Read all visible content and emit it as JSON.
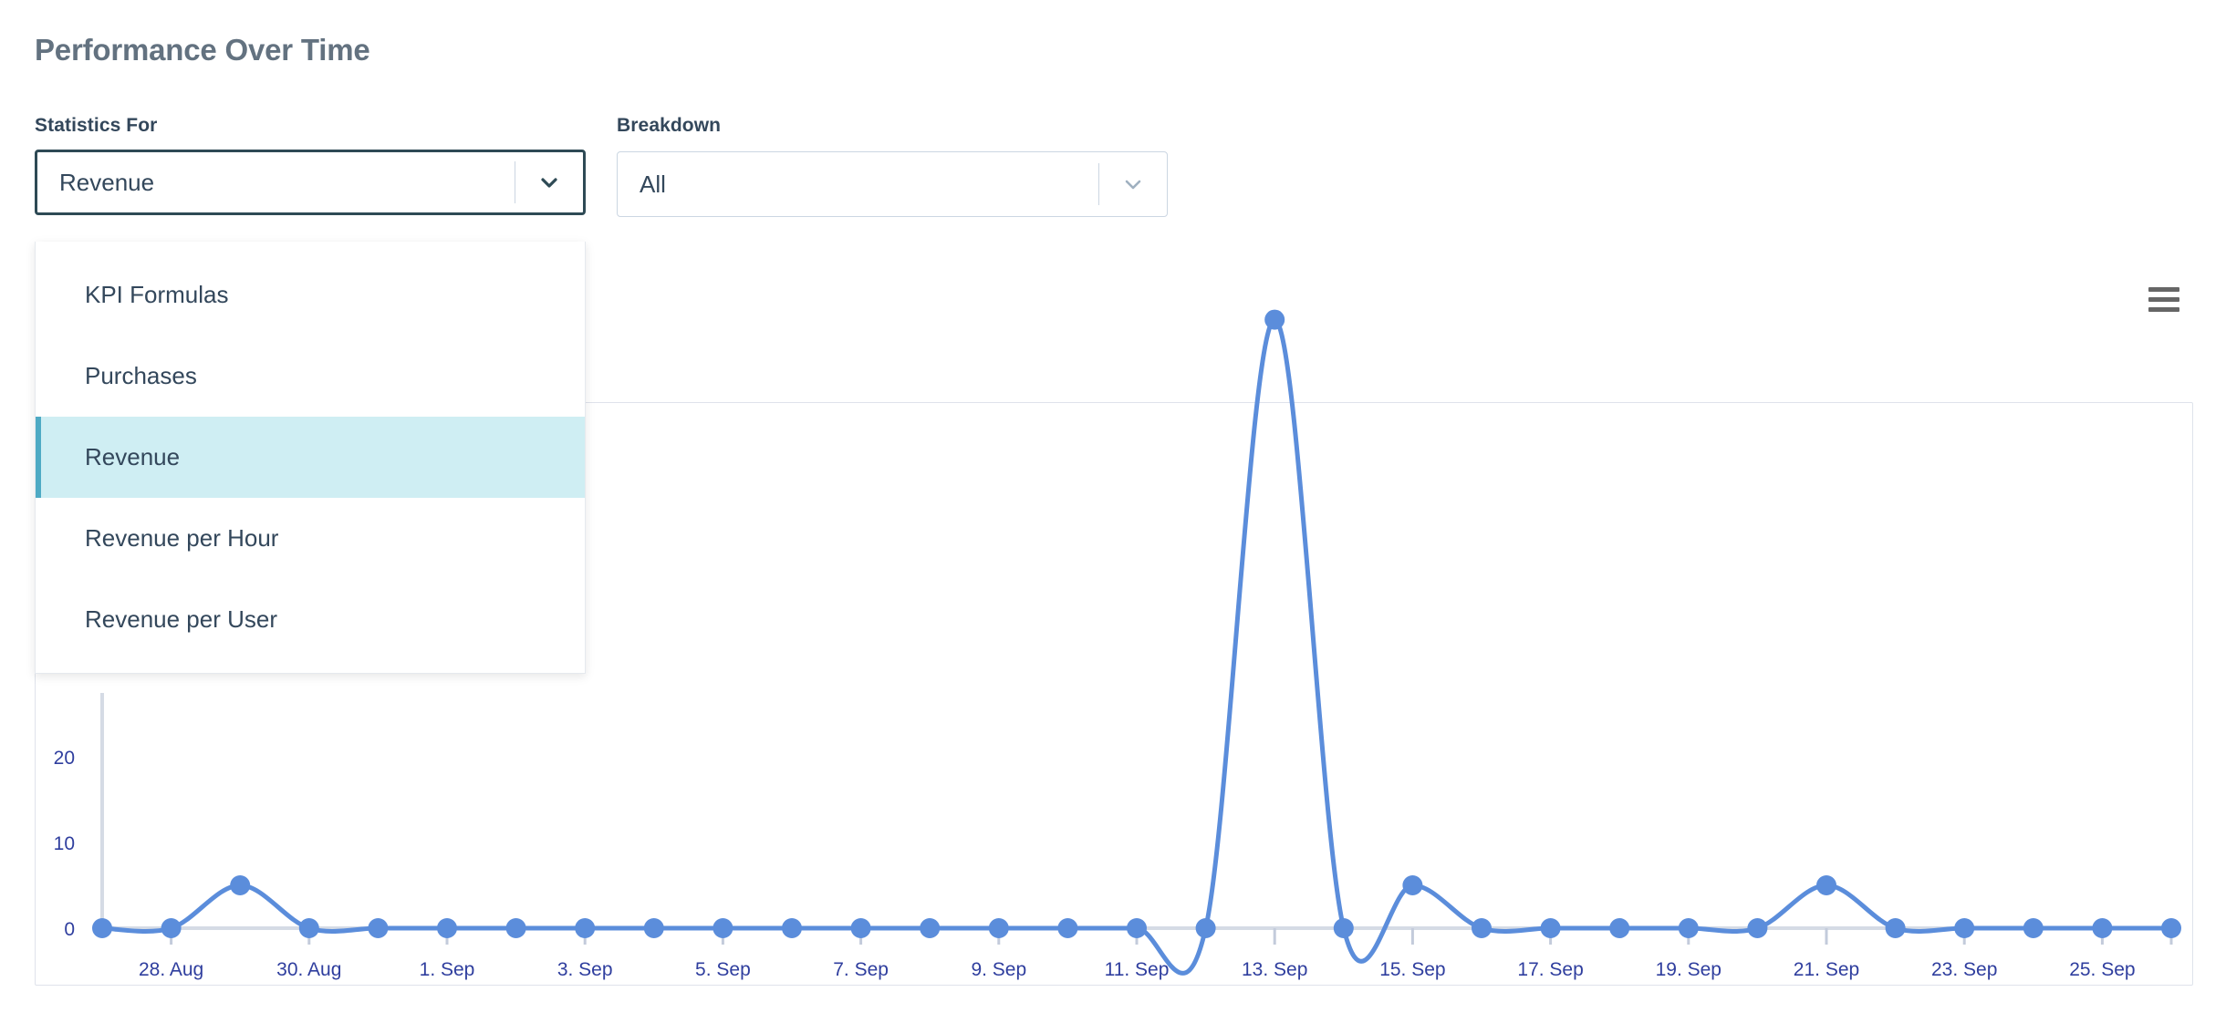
{
  "panel": {
    "title": "Performance Over Time"
  },
  "controls": {
    "statistics": {
      "label": "Statistics For",
      "value": "Revenue",
      "chevron_icon": "chevron-down-icon",
      "options": [
        {
          "label": "KPI Formulas",
          "selected": false
        },
        {
          "label": "Purchases",
          "selected": false
        },
        {
          "label": "Revenue",
          "selected": true
        },
        {
          "label": "Revenue per Hour",
          "selected": false
        },
        {
          "label": "Revenue per User",
          "selected": false
        }
      ]
    },
    "breakdown": {
      "label": "Breakdown",
      "value": "All",
      "chevron_icon": "chevron-down-icon"
    }
  },
  "chart_toolbar": {
    "menu_icon": "hamburger-menu-icon"
  },
  "colors": {
    "series_line": "#5b8ddb",
    "axis_line": "#d5dbe5",
    "tick_label": "#2f3e9e",
    "selected_item_bg": "#cfeef3",
    "selected_item_bar": "#4eaac4",
    "focus_border": "#2e4a55",
    "title_text": "#637280"
  },
  "chart_data": {
    "type": "line",
    "title": "",
    "xlabel": "",
    "ylabel": "",
    "ylim": [
      0,
      75
    ],
    "yticks": [
      0,
      10,
      20
    ],
    "ytick_labels": [
      "0",
      "10",
      "20"
    ],
    "grid": false,
    "legend": "none",
    "xtick_labels": [
      "28. Aug",
      "30. Aug",
      "1. Sep",
      "3. Sep",
      "5. Sep",
      "7. Sep",
      "9. Sep",
      "11. Sep",
      "13. Sep",
      "15. Sep",
      "17. Sep",
      "19. Sep",
      "21. Sep",
      "23. Sep",
      "25. Sep"
    ],
    "x": [
      "27. Aug",
      "28. Aug",
      "29. Aug",
      "30. Aug",
      "31. Aug",
      "1. Sep",
      "2. Sep",
      "3. Sep",
      "4. Sep",
      "5. Sep",
      "6. Sep",
      "7. Sep",
      "8. Sep",
      "9. Sep",
      "10. Sep",
      "11. Sep",
      "12. Sep",
      "13. Sep",
      "14. Sep",
      "15. Sep",
      "16. Sep",
      "17. Sep",
      "18. Sep",
      "19. Sep",
      "20. Sep",
      "21. Sep",
      "22. Sep",
      "23. Sep",
      "24. Sep",
      "25. Sep",
      "26. Sep"
    ],
    "series": [
      {
        "name": "Revenue",
        "color": "#5b8ddb",
        "values": [
          0,
          0,
          5,
          0,
          0,
          0,
          0,
          0,
          0,
          0,
          0,
          0,
          0,
          0,
          0,
          0,
          0,
          71,
          0,
          5,
          0,
          0,
          0,
          0,
          0,
          5,
          0,
          0,
          0,
          0,
          0
        ]
      }
    ]
  }
}
